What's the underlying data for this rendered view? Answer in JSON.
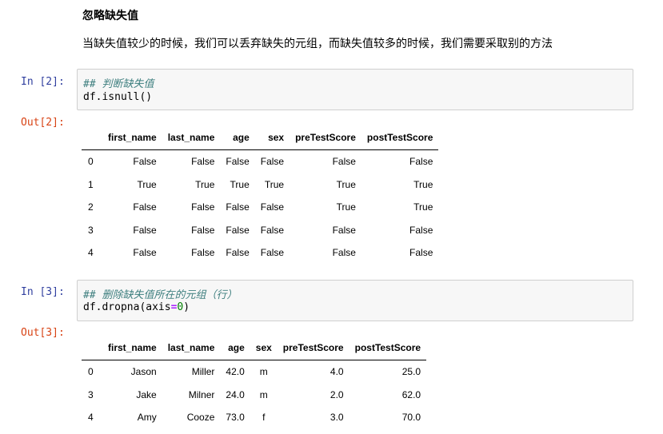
{
  "markdown": {
    "heading": "忽略缺失值",
    "text": "当缺失值较少的时候，我们可以丢弃缺失的元组，而缺失值较多的时候，我们需要采取别的方法"
  },
  "cell1": {
    "in_prompt": "In [2]:",
    "out_prompt": "Out[2]:",
    "comment": "## 判断缺失值",
    "code": "df.isnull()",
    "columns": [
      "first_name",
      "last_name",
      "age",
      "sex",
      "preTestScore",
      "postTestScore"
    ],
    "rows": [
      {
        "idx": "0",
        "vals": [
          "False",
          "False",
          "False",
          "False",
          "False",
          "False"
        ]
      },
      {
        "idx": "1",
        "vals": [
          "True",
          "True",
          "True",
          "True",
          "True",
          "True"
        ]
      },
      {
        "idx": "2",
        "vals": [
          "False",
          "False",
          "False",
          "False",
          "True",
          "True"
        ]
      },
      {
        "idx": "3",
        "vals": [
          "False",
          "False",
          "False",
          "False",
          "False",
          "False"
        ]
      },
      {
        "idx": "4",
        "vals": [
          "False",
          "False",
          "False",
          "False",
          "False",
          "False"
        ]
      }
    ]
  },
  "cell2": {
    "in_prompt": "In [3]:",
    "out_prompt": "Out[3]:",
    "comment": "## 删除缺失值所在的元组（行）",
    "code_prefix": "df.dropna(axis",
    "code_eq": "=",
    "code_num": "0",
    "code_suffix": ")",
    "columns": [
      "first_name",
      "last_name",
      "age",
      "sex",
      "preTestScore",
      "postTestScore"
    ],
    "rows": [
      {
        "idx": "0",
        "vals": [
          "Jason",
          "Miller",
          "42.0",
          "m",
          "4.0",
          "25.0"
        ]
      },
      {
        "idx": "3",
        "vals": [
          "Jake",
          "Milner",
          "24.0",
          "m",
          "2.0",
          "62.0"
        ]
      },
      {
        "idx": "4",
        "vals": [
          "Amy",
          "Cooze",
          "73.0",
          "f",
          "3.0",
          "70.0"
        ]
      }
    ]
  }
}
